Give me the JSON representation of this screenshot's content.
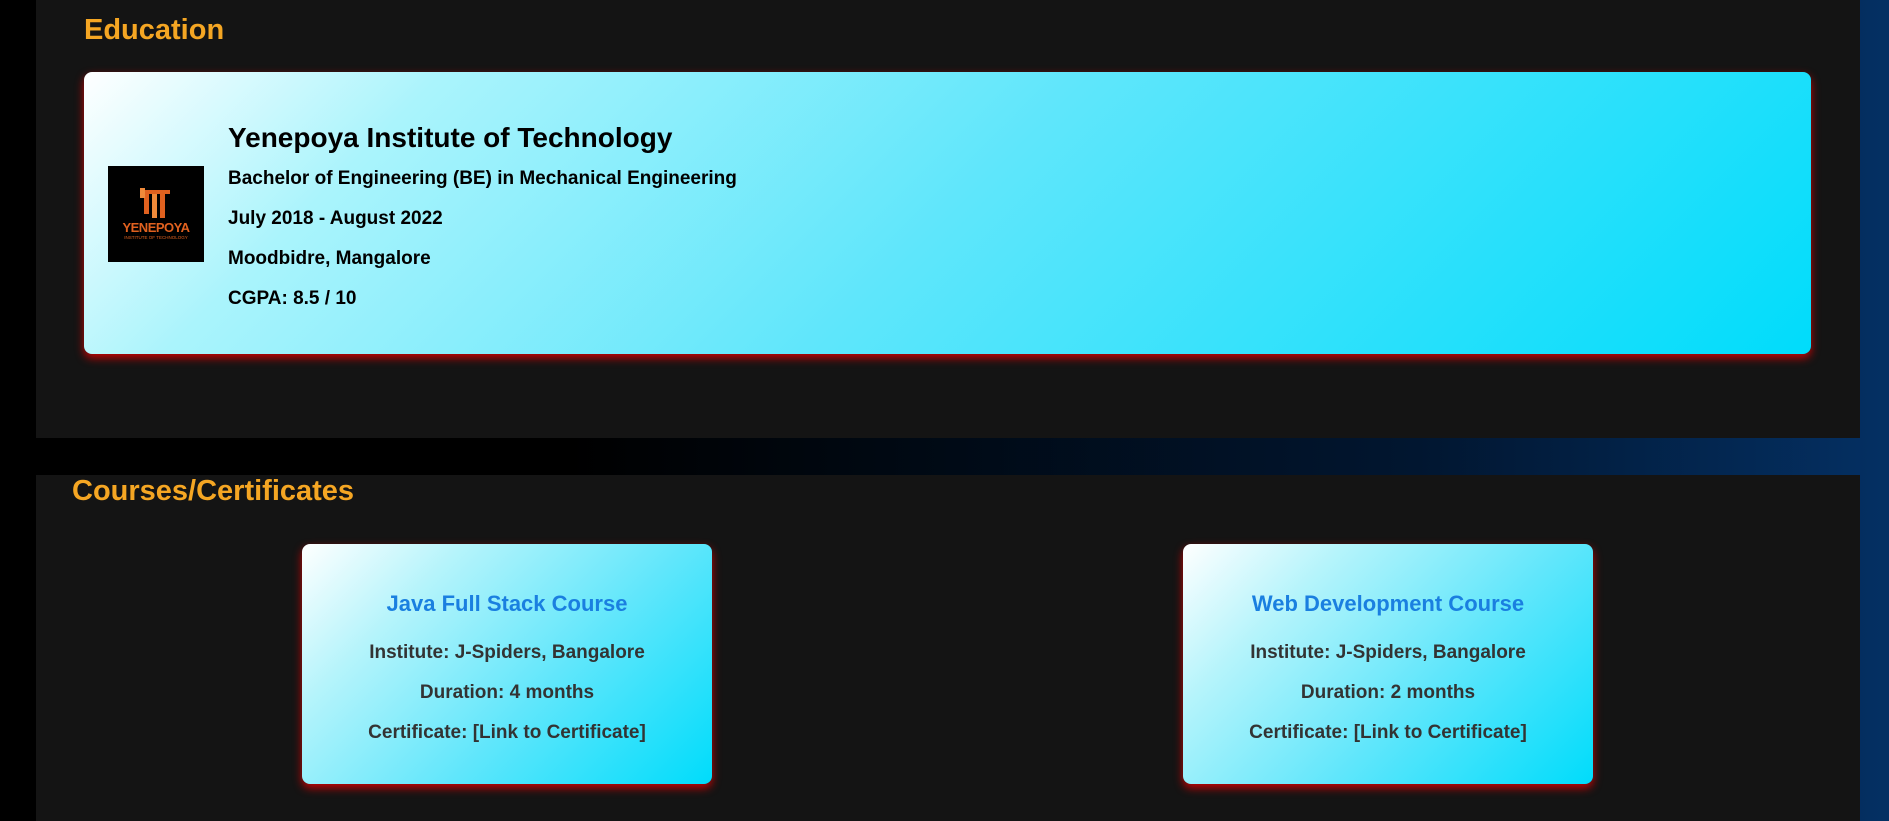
{
  "education": {
    "heading": "Education",
    "entries": [
      {
        "logo_text": "YENEPOYA",
        "logo_subtext": "INSTITUTE OF TECHNOLOGY",
        "institution": "Yenepoya Institute of Technology",
        "degree": "Bachelor of Engineering (BE) in Mechanical Engineering",
        "period": "July 2018 - August 2022",
        "location": "Moodbidre, Mangalore",
        "grade": "CGPA: 8.5 / 10"
      }
    ]
  },
  "courses": {
    "heading": "Courses/Certificates",
    "items": [
      {
        "title": "Java Full Stack Course",
        "institute": "Institute: J-Spiders, Bangalore",
        "duration": "Duration: 4 months",
        "certificate_label": "Certificate: ",
        "certificate_link": "[Link to Certificate]"
      },
      {
        "title": "Web Development Course",
        "institute": "Institute: J-Spiders, Bangalore",
        "duration": "Duration: 2 months",
        "certificate_label": "Certificate: ",
        "certificate_link": "[Link to Certificate]"
      }
    ]
  },
  "colors": {
    "heading": "#f5a623",
    "course_title": "#1a7fe0",
    "card_shadow": "#e60000",
    "card_gradient_end": "#00dcfb"
  }
}
